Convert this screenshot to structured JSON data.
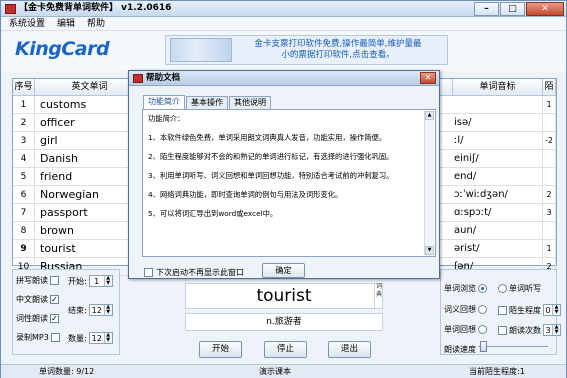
{
  "app": {
    "title": "【金卡免费背单词软件】 v1.2.0616",
    "controls": {
      "minimize": "–",
      "maximize": "□",
      "close": "✕"
    }
  },
  "menu": {
    "items": [
      "系统设置",
      "编辑",
      "帮助"
    ]
  },
  "header": {
    "logo": "KingCard",
    "banner_line1": "金卡支票打印软件免费,操作最简单,维护量最",
    "banner_line2": "小的票据打印软件,点击查看。"
  },
  "table": {
    "headers": {
      "num": "序号",
      "word": "英文单词",
      "phonetic": "单词音标",
      "extra": "陌"
    },
    "rows": [
      {
        "num": "1",
        "word": "customs",
        "phonetic": "",
        "extra": "1"
      },
      {
        "num": "2",
        "word": "officer",
        "phonetic": "isə/",
        "extra": ""
      },
      {
        "num": "3",
        "word": "girl",
        "phonetic": "ːl/",
        "extra": "-2"
      },
      {
        "num": "4",
        "word": "Danish",
        "phonetic": "einiʃ/",
        "extra": ""
      },
      {
        "num": "5",
        "word": "friend",
        "phonetic": "end/",
        "extra": ""
      },
      {
        "num": "6",
        "word": "Norwegian",
        "phonetic": "ɔːˈwiːdʒən/",
        "extra": "2"
      },
      {
        "num": "7",
        "word": "passport",
        "phonetic": "ɑːspɔːt/",
        "extra": "3"
      },
      {
        "num": "8",
        "word": "brown",
        "phonetic": "aun/",
        "extra": ""
      },
      {
        "num": "9",
        "word": "tourist",
        "phonetic": "ərist/",
        "extra": "1"
      },
      {
        "num": "10",
        "word": "Russian",
        "phonetic": "ʃən/",
        "extra": "2"
      }
    ]
  },
  "controls_left": {
    "spell_read": "拼写朗读",
    "cn_read": "中文朗读",
    "phrase_read": "词性朗读",
    "record_mp3": "录制MP3",
    "start_label": "开始:",
    "start_value": "1",
    "end_label": "结束:",
    "end_value": "12",
    "count_label": "数量:",
    "count_value": "12"
  },
  "display": {
    "word": "tourist",
    "side_mark": "词典",
    "meaning": "n.旅游者"
  },
  "buttons": {
    "start": "开始",
    "stop": "停止",
    "exit": "退出"
  },
  "controls_right": {
    "browse": "单词浏览",
    "dictation": "单词听写",
    "recall": "词义回想",
    "memory_level": "陌生程度",
    "memory_value": "0",
    "word_recall": "单词回想",
    "read_times": "朗读次数",
    "read_times_value": "3",
    "speed": "朗读速度"
  },
  "status": {
    "word_count": "单词数量: 9/12",
    "lesson": "演示课本",
    "level": "当前陌生程度:1"
  },
  "dialog": {
    "title": "帮助文档",
    "close": "✕",
    "tabs": [
      "功能简介",
      "基本操作",
      "其他说明"
    ],
    "heading": "功能简介：",
    "lines": [
      "1、本软件绿色免费，单词采用朗文词典真人发音，功能实用，操作简便。",
      "2、陌生程度能够对不会的和熟记的单词进行标记，有选择的进行强化巩固。",
      "3、利用单词听写、词义回想和单词回想功能，特别适合考试前的冲刺复习。",
      "4、网络词典功能，即时查询单词的例句与用法及词形变化。",
      "5、可以将词汇导出到word或excel中。"
    ],
    "checkbox": "下次启动不再显示此窗口",
    "ok": "确定"
  }
}
